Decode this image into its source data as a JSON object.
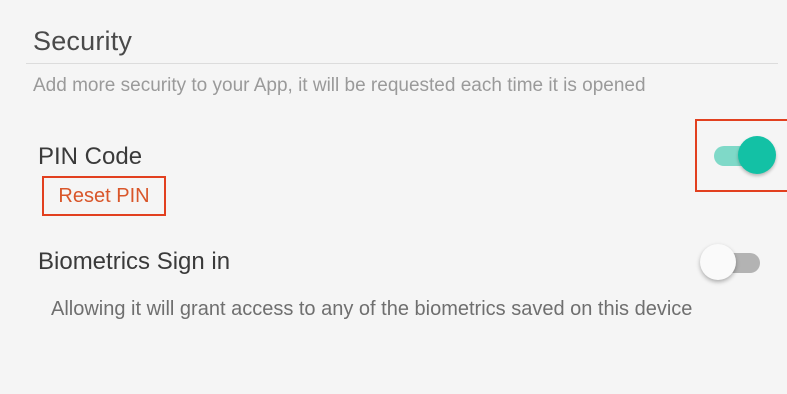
{
  "security": {
    "title": "Security",
    "description": "Add more security to your App, it will be requested each time it is opened"
  },
  "pin_code": {
    "label": "PIN Code",
    "enabled": true,
    "reset_label": "Reset PIN"
  },
  "biometrics": {
    "label": "Biometrics Sign in",
    "enabled": false,
    "description": "Allowing it will grant access to any of the biometrics saved on this device"
  },
  "colors": {
    "toggle_on_thumb": "#13c1a5",
    "toggle_on_track": "#7fd9c8",
    "toggle_off_track": "#b3b3b3",
    "highlight_border": "#e2401f",
    "reset_text": "#d9562a"
  }
}
